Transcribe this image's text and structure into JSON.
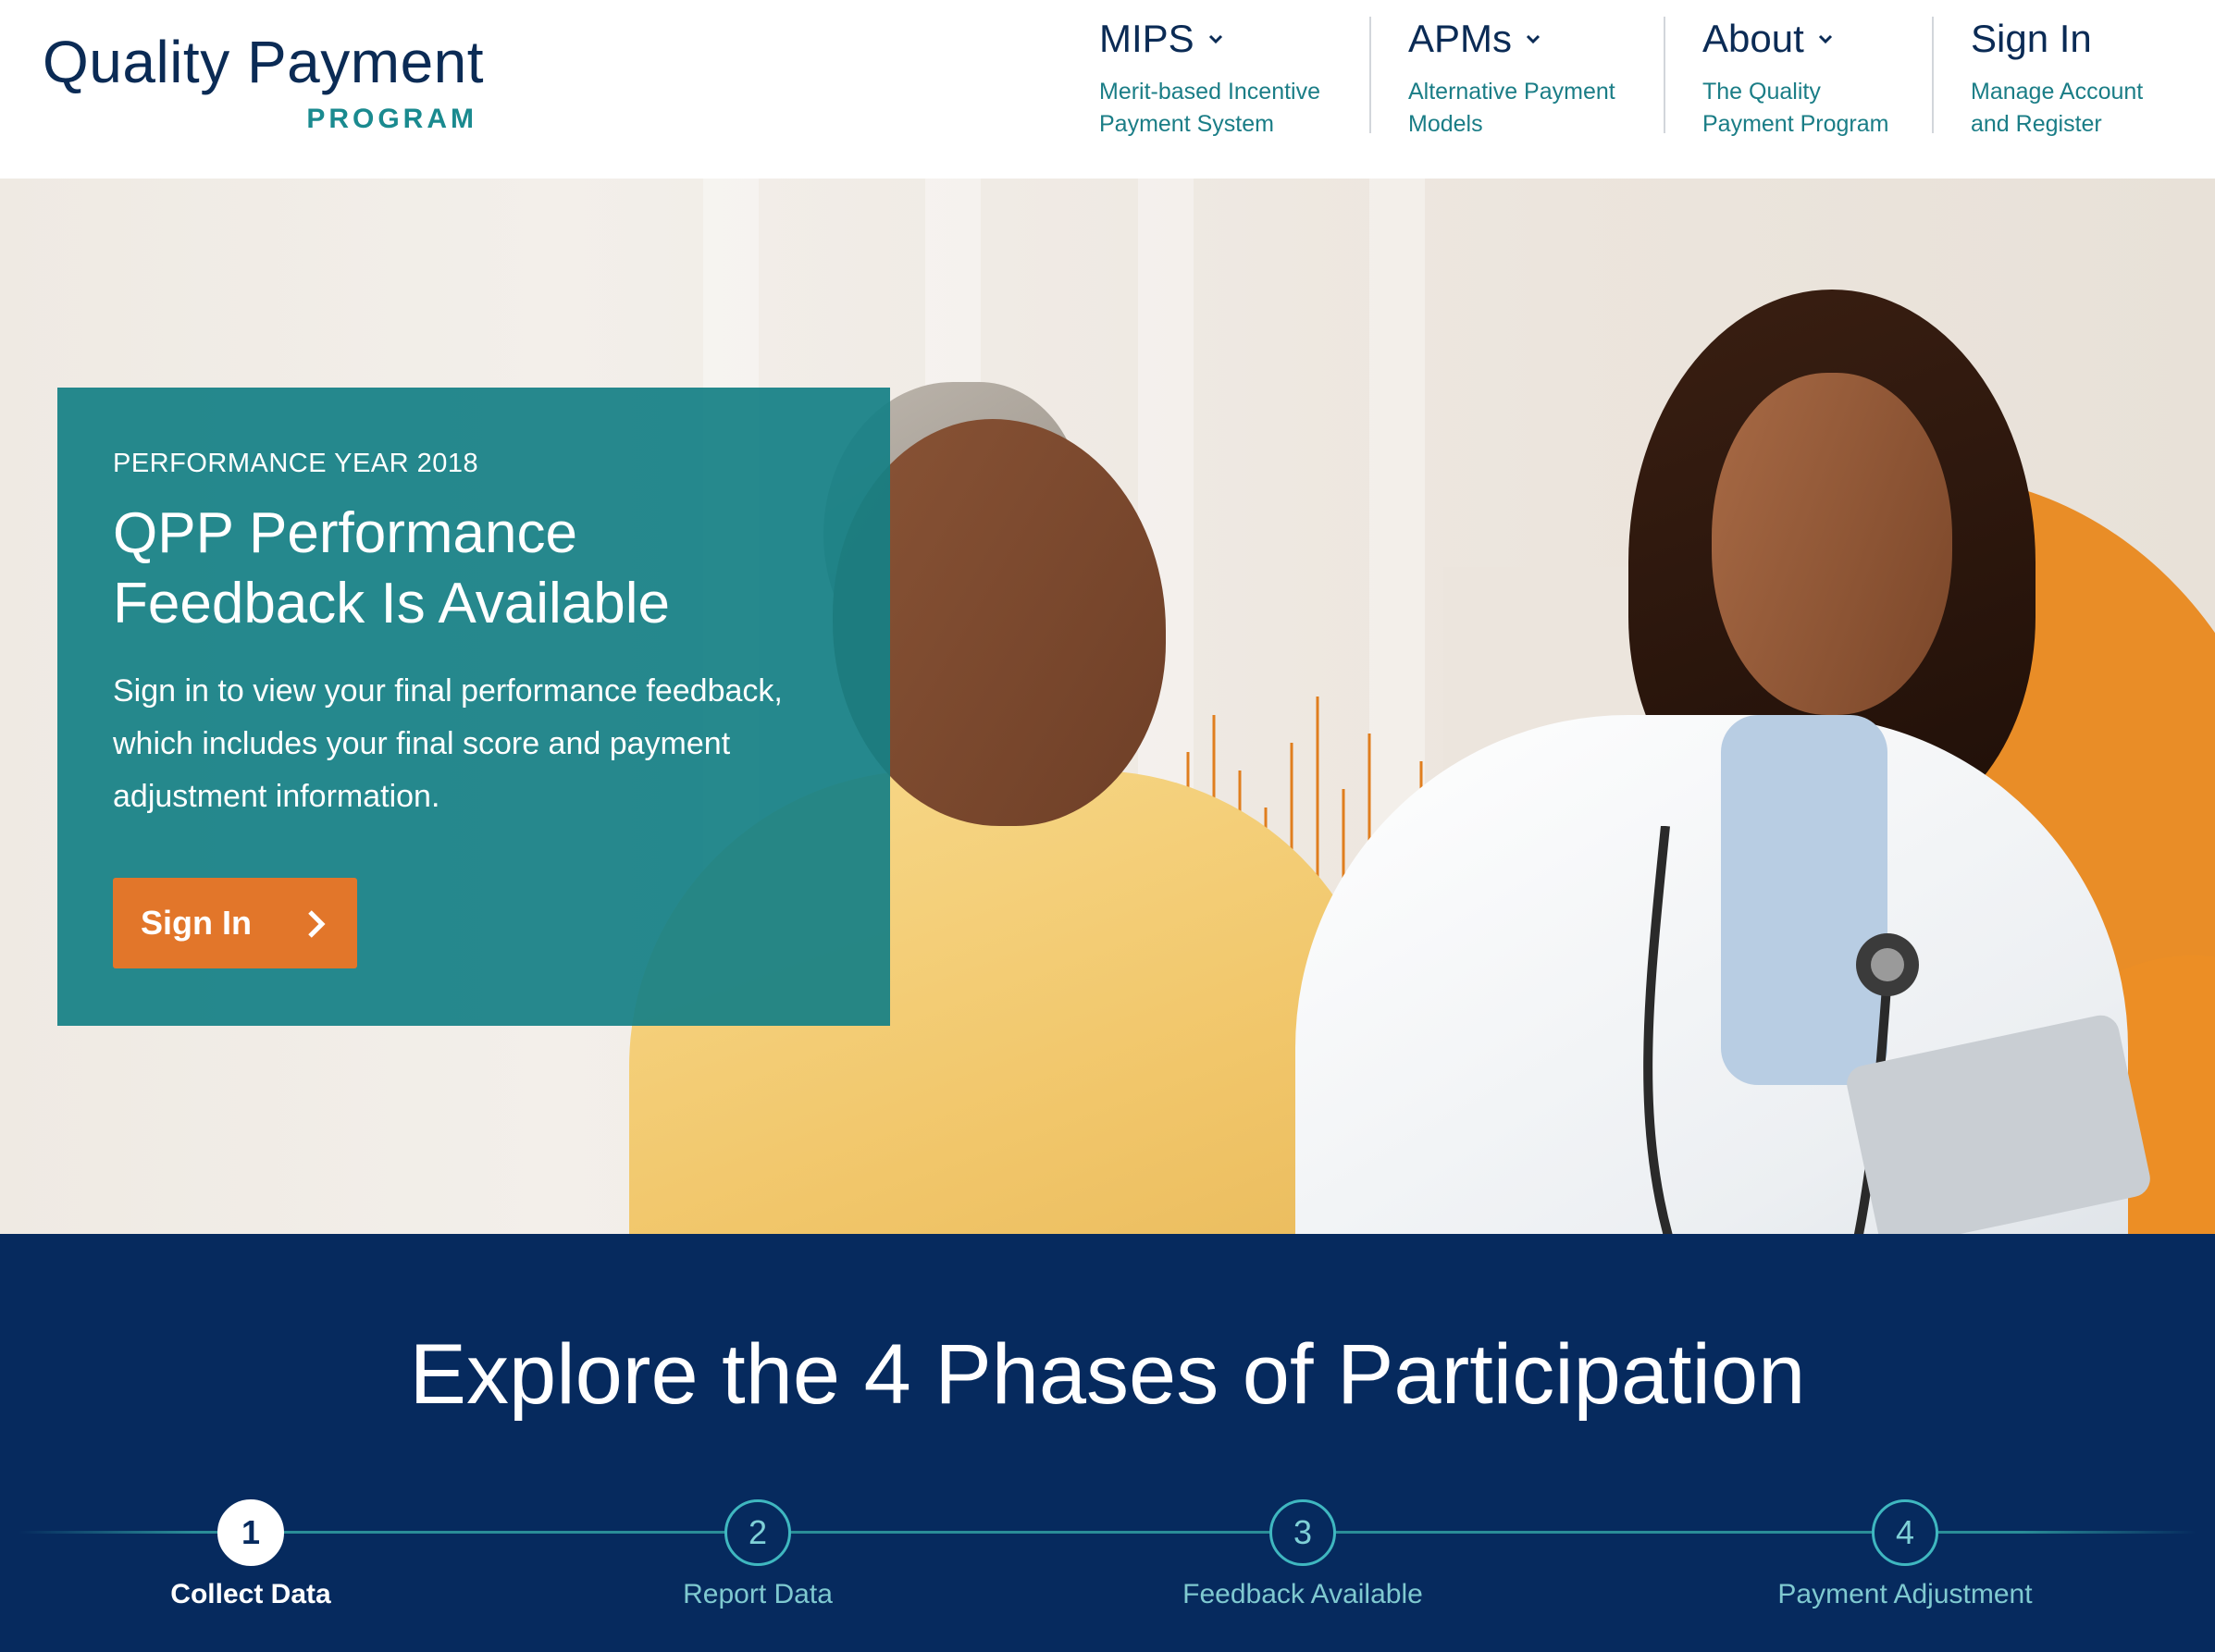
{
  "logo": {
    "line1": "Quality Payment",
    "line2": "PROGRAM"
  },
  "nav": [
    {
      "title": "MIPS",
      "subtitle_line1": "Merit-based Incentive",
      "subtitle_line2": "Payment System",
      "has_dropdown": true
    },
    {
      "title": "APMs",
      "subtitle_line1": "Alternative Payment",
      "subtitle_line2": "Models",
      "has_dropdown": true
    },
    {
      "title": "About",
      "subtitle_line1": "The Quality",
      "subtitle_line2": "Payment Program",
      "has_dropdown": true
    },
    {
      "title": "Sign In",
      "subtitle_line1": "Manage Account",
      "subtitle_line2": "and Register",
      "has_dropdown": false
    }
  ],
  "hero": {
    "eyebrow": "PERFORMANCE YEAR 2018",
    "title": "QPP Performance Feedback Is Available",
    "text": "Sign in to view your final performance feedback, which includes your final score and payment adjustment information.",
    "button_label": "Sign In"
  },
  "phases": {
    "title": "Explore the 4 Phases of Participation",
    "items": [
      {
        "number": "1",
        "label": "Collect Data",
        "active": true
      },
      {
        "number": "2",
        "label": "Report Data",
        "active": false
      },
      {
        "number": "3",
        "label": "Feedback Available",
        "active": false
      },
      {
        "number": "4",
        "label": "Payment Adjustment",
        "active": false
      }
    ]
  },
  "colors": {
    "navy": "#0b2b55",
    "teal": "#1a8a8f",
    "orange": "#e2762a",
    "phases_bg": "#062a5e"
  }
}
